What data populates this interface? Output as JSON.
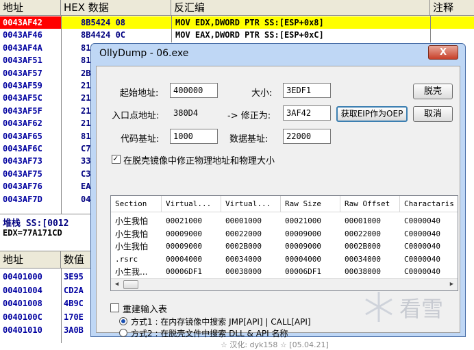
{
  "cpu": {
    "headers": {
      "address": "地址",
      "hex": "HEX 数据",
      "disasm": "反汇编",
      "comment": "注释"
    },
    "rows": [
      {
        "addr": "0043AF42",
        "hex": "8B5424 08",
        "dis": "MOV EDX,DWORD PTR SS:[ESP+0x8]"
      },
      {
        "addr": "0043AF46",
        "hex": "8B4424 0C",
        "dis": "MOV EAX,DWORD PTR SS:[ESP+0xC]"
      },
      {
        "addr": "0043AF4A",
        "hex": "81",
        "dis": ""
      },
      {
        "addr": "0043AF51",
        "hex": "81",
        "dis": ""
      },
      {
        "addr": "0043AF57",
        "hex": "2B",
        "dis": ""
      },
      {
        "addr": "0043AF59",
        "hex": "21",
        "dis": ""
      },
      {
        "addr": "0043AF5C",
        "hex": "21",
        "dis": ""
      },
      {
        "addr": "0043AF5F",
        "hex": "21",
        "dis": ""
      },
      {
        "addr": "0043AF62",
        "hex": "21",
        "dis": ""
      },
      {
        "addr": "0043AF65",
        "hex": "81",
        "dis": ""
      },
      {
        "addr": "0043AF6C",
        "hex": "C7",
        "dis": ""
      },
      {
        "addr": "0043AF73",
        "hex": "33",
        "dis": ""
      },
      {
        "addr": "0043AF75",
        "hex": "C3",
        "dis": ""
      },
      {
        "addr": "0043AF76",
        "hex": "EA",
        "dis": ""
      },
      {
        "addr": "0043AF7D",
        "hex": "04",
        "dis": ""
      }
    ],
    "stack_line": "堆栈 SS:[0012",
    "edx_line": "EDX=77A171CD"
  },
  "dump": {
    "headers": {
      "address": "地址",
      "value": "数值"
    },
    "rows": [
      {
        "addr": "00401000",
        "val": "3E95"
      },
      {
        "addr": "00401004",
        "val": "CD2A"
      },
      {
        "addr": "00401008",
        "val": "4B9C"
      },
      {
        "addr": "0040100C",
        "val": "170E"
      },
      {
        "addr": "00401010",
        "val": "3A0B"
      }
    ]
  },
  "dialog": {
    "title": "OllyDump - 06.exe",
    "close_label": "X",
    "start_addr_label": "起始地址:",
    "start_addr_value": "400000",
    "size_label": "大小:",
    "size_value": "3EDF1",
    "dump_btn": "脱壳",
    "entry_label": "入口点地址:",
    "entry_value": "380D4",
    "modify_label": "-> 修正为:",
    "modify_value": "3AF42",
    "get_eip_btn": "获取EIP作为OEP",
    "cancel_btn": "取消",
    "code_base_label": "代码基址:",
    "code_base_value": "1000",
    "data_base_label": "数据基址:",
    "data_base_value": "22000",
    "fix_check_label": "在脱壳镜像中修正物理地址和物理大小",
    "table": {
      "columns": [
        "Section",
        "Virtual...",
        "Virtual...",
        "Raw Size",
        "Raw Offset",
        "Charactaris"
      ],
      "rows": [
        [
          "小生我怕",
          "00021000",
          "00001000",
          "00021000",
          "00001000",
          "C0000040"
        ],
        [
          "小生我怕",
          "00009000",
          "00022000",
          "00009000",
          "00022000",
          "C0000040"
        ],
        [
          "小生我怕",
          "00009000",
          "0002B000",
          "00009000",
          "0002B000",
          "C0000040"
        ],
        [
          ".rsrc",
          "00004000",
          "00034000",
          "00004000",
          "00034000",
          "C0000040"
        ],
        [
          "小生我...",
          "00006DF1",
          "00038000",
          "00006DF1",
          "00038000",
          "C0000040"
        ]
      ]
    },
    "rebuild_label": "重建输入表",
    "method1_label": "方式1 : 在内存镜像中搜索 JMP[API] | CALL[API]",
    "method2_label": "方式2 : 在脱壳文件中搜索 DLL & API 名称",
    "credit": "☆ 汉化: dyk158 ☆ [05.04.21]"
  },
  "watermark": "看雪"
}
